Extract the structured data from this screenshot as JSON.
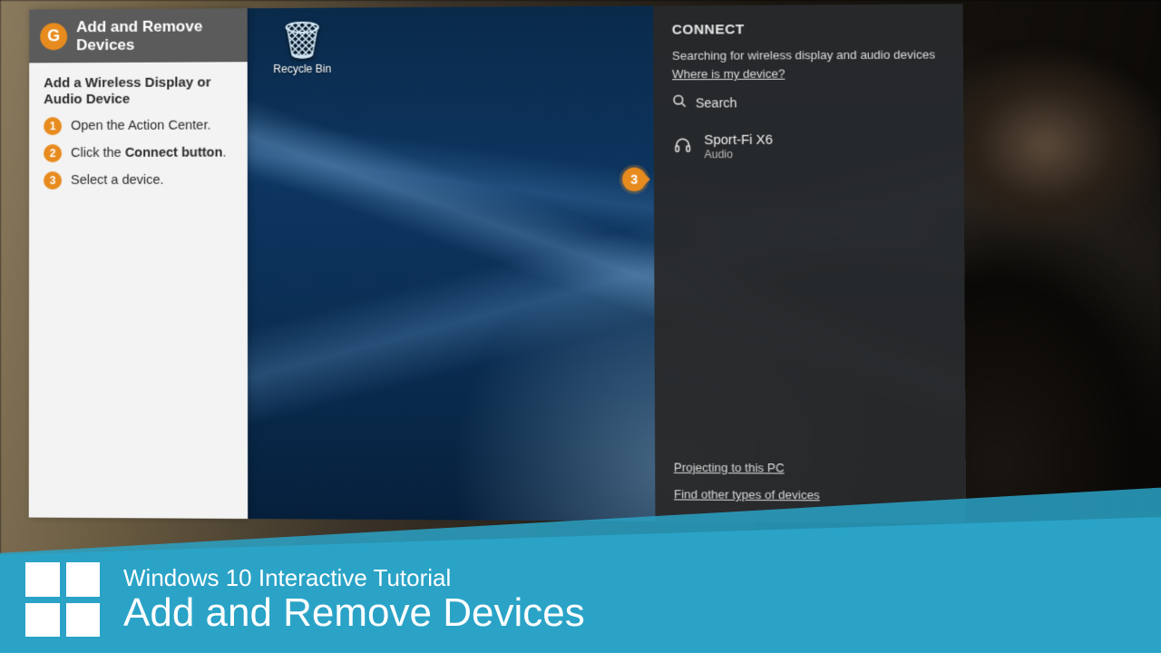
{
  "tutorial": {
    "brand_letter": "G",
    "title": "Add and Remove Devices",
    "section": "Add a Wireless Display or Audio Device",
    "steps": [
      {
        "num": "1",
        "text": "Open the Action Center."
      },
      {
        "num": "2",
        "text_prefix": "Click the ",
        "text_bold": "Connect button",
        "text_suffix": "."
      },
      {
        "num": "3",
        "text": "Select a device."
      }
    ],
    "active_callout": "3"
  },
  "desktop": {
    "recycle_bin_label": "Recycle Bin"
  },
  "connect": {
    "title": "CONNECT",
    "status": "Searching for wireless display and audio devices",
    "help_link": "Where is my device?",
    "search_label": "Search",
    "device": {
      "name": "Sport-Fi X6",
      "type": "Audio"
    },
    "footer_links": [
      "Projecting to this PC",
      "Find other types of devices"
    ]
  },
  "banner": {
    "line1": "Windows 10 Interactive Tutorial",
    "line2": "Add and Remove Devices"
  }
}
